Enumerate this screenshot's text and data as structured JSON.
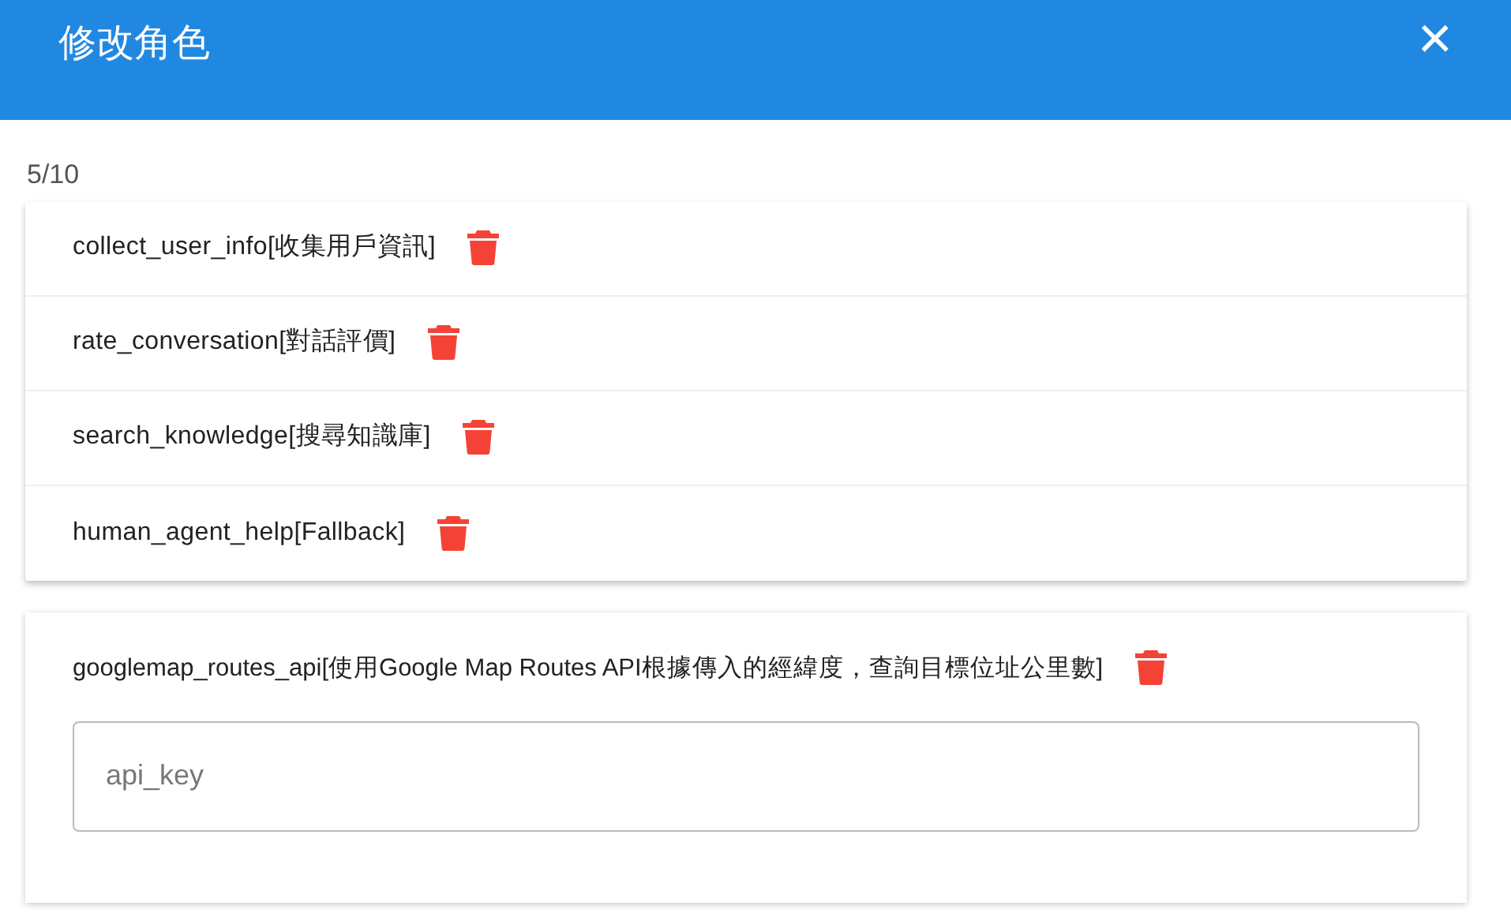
{
  "dialog": {
    "title": "修改角色",
    "close": "×"
  },
  "counter": "5/10",
  "tools": [
    {
      "label": "collect_user_info[收集用戶資訊]"
    },
    {
      "label": "rate_conversation[對話評價]"
    },
    {
      "label": "search_knowledge[搜尋知識庫]"
    },
    {
      "label": "human_agent_help[Fallback]"
    }
  ],
  "api_tools": [
    {
      "label": "googlemap_routes_api[使用Google Map Routes API根據傳入的經緯度，查詢目標位址公里數]",
      "field": {
        "placeholder": "api_key"
      }
    }
  ]
}
